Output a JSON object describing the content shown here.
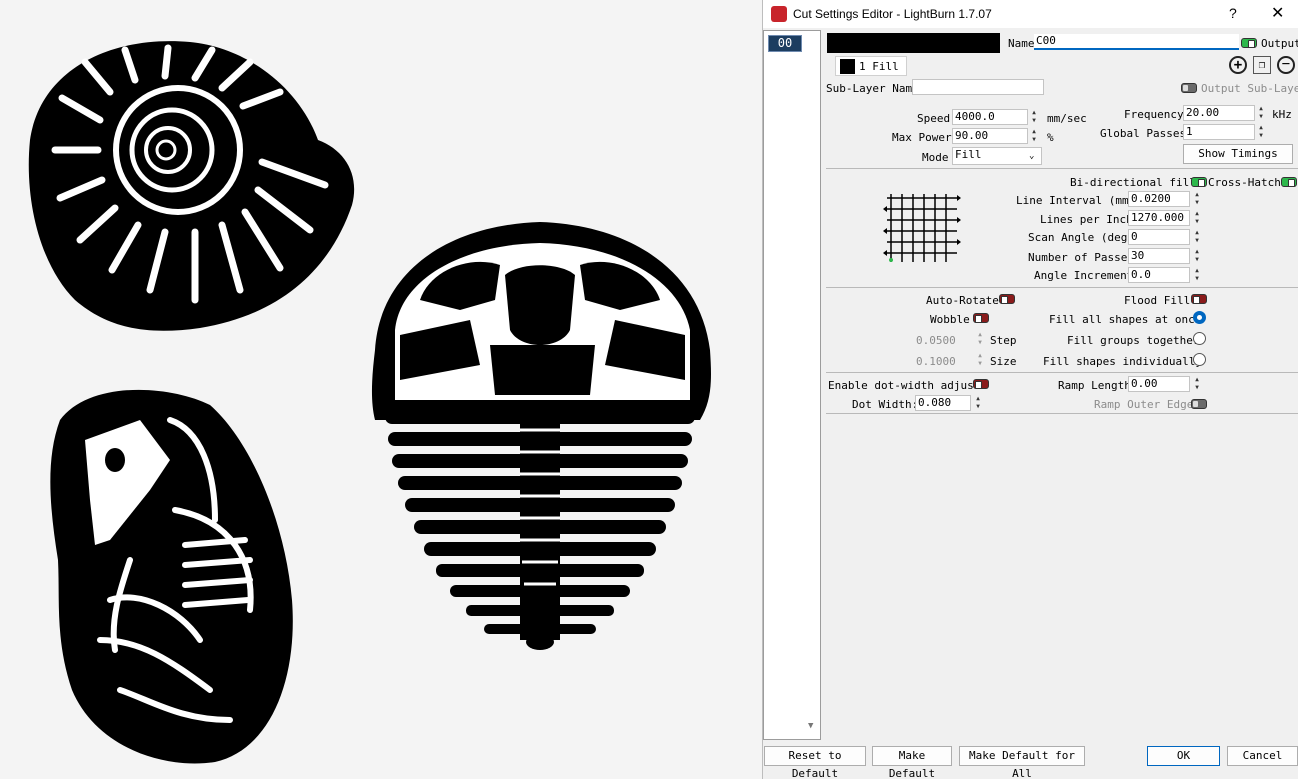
{
  "dialog": {
    "title": "Cut Settings Editor - LightBurn 1.7.07",
    "help": "?",
    "close": "✕",
    "layer_chip": "00",
    "name_label": "Name",
    "name_value": "C00",
    "output_label": "Output",
    "sublayer_tab": "1 Fill",
    "sublayer_name_label": "Sub-Layer Name",
    "output_sublayer_label": "Output Sub-Layer",
    "speed_label": "Speed",
    "speed_value": "4000.0",
    "speed_unit": "mm/sec",
    "maxpower_label": "Max Power",
    "maxpower_value": "90.00",
    "maxpower_unit": "%",
    "mode_label": "Mode",
    "mode_value": "Fill",
    "frequency_label": "Frequency",
    "frequency_value": "20.00",
    "frequency_unit": "kHz",
    "globalpasses_label": "Global Passes",
    "globalpasses_value": "1",
    "show_timings": "Show Timings",
    "bidir_label": "Bi-directional fill",
    "crosshatch_label": "Cross-Hatch",
    "line_interval_label": "Line Interval (mm)",
    "line_interval_value": "0.0200",
    "lpi_label": "Lines per Inch",
    "lpi_value": "1270.000",
    "scan_angle_label": "Scan Angle (deg)",
    "scan_angle_value": "0",
    "passes_label": "Number of Passes",
    "passes_value": "30",
    "angle_inc_label": "Angle Increment",
    "angle_inc_value": "0.0",
    "autorotate_label": "Auto-Rotate",
    "wobble_label": "Wobble",
    "step_value": "0.0500",
    "step_label": "Step",
    "size_value": "0.1000",
    "size_label": "Size",
    "floodfill_label": "Flood Fill",
    "fill_all_label": "Fill all shapes at once",
    "fill_groups_label": "Fill groups together",
    "fill_individual_label": "Fill shapes individually",
    "dotwidth_adjust_label": "Enable dot-width adjust",
    "dotwidth_label": "Dot Width:",
    "dotwidth_value": "0.080",
    "ramp_length_label": "Ramp Length",
    "ramp_length_value": "0.00",
    "ramp_outer_label": "Ramp Outer Edge",
    "reset_default": "Reset to Default",
    "make_default": "Make Default",
    "make_default_all": "Make Default for All",
    "ok": "OK",
    "cancel": "Cancel"
  },
  "colors": {
    "accent": "#0067c0",
    "toggle_on": "#2db84b",
    "toggle_off": "#8a1b1b",
    "layer_chip": "#1c3d60"
  }
}
